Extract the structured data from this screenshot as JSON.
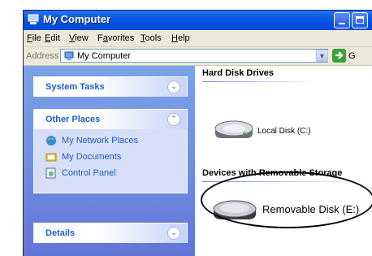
{
  "window": {
    "title": "My Computer",
    "buttons": [
      "minimize",
      "maximize"
    ]
  },
  "menubar": {
    "items": [
      {
        "label": "File",
        "accesskey": "F"
      },
      {
        "label": "Edit",
        "accesskey": "E"
      },
      {
        "label": "View",
        "accesskey": "V"
      },
      {
        "label": "Favorites",
        "accesskey": "a"
      },
      {
        "label": "Tools",
        "accesskey": "T"
      },
      {
        "label": "Help",
        "accesskey": "H"
      }
    ]
  },
  "addressbar": {
    "label": "Address",
    "value": "My Computer",
    "go_label": "G"
  },
  "sidebar": {
    "system_tasks": {
      "title": "System Tasks"
    },
    "other_places": {
      "title": "Other Places",
      "links": [
        "My Network Places",
        "My Documents",
        "Control Panel"
      ]
    },
    "details": {
      "title": "Details"
    }
  },
  "content": {
    "hard_disks": {
      "header": "Hard Disk Drives",
      "drives": [
        {
          "label": "Local Disk (C:)"
        }
      ]
    },
    "removable": {
      "header": "Devices with Removable Storage",
      "drives": [
        {
          "label": "Removable Disk (E:)"
        }
      ]
    }
  },
  "colors": {
    "titlebar": "#0a55e3",
    "sidebar": "#6f8fe0",
    "panel_text": "#215dc6"
  }
}
